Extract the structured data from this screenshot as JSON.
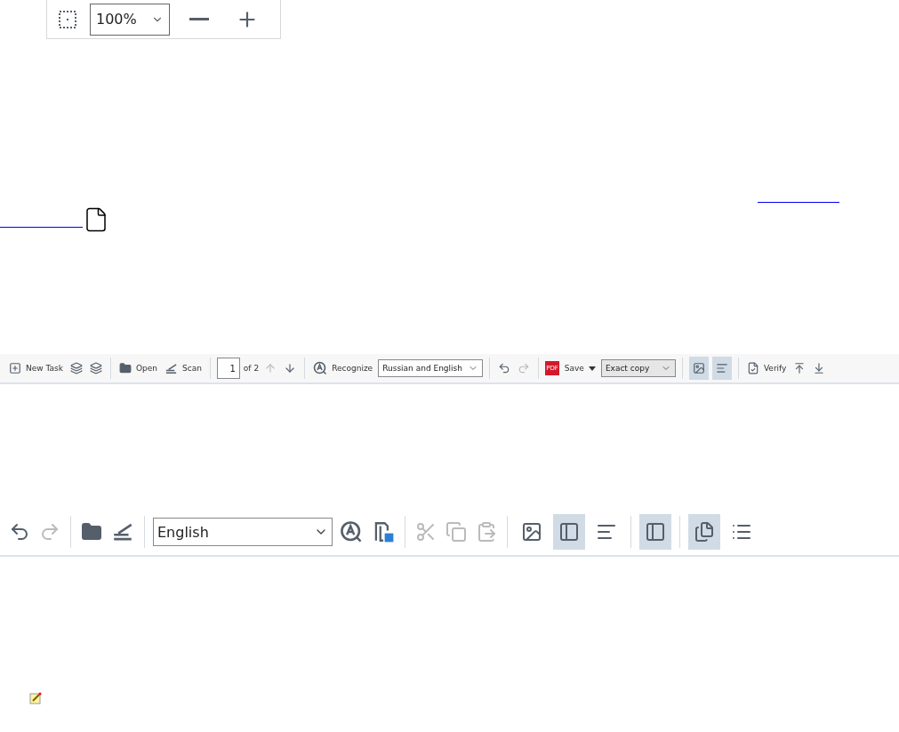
{
  "zoom_toolbar": {
    "zoom_value": "100%"
  },
  "main_toolbar": {
    "new_task": "New Task",
    "open": "Open",
    "scan": "Scan",
    "page_field": "1",
    "page_count": "of 2",
    "previous_page_disabled": true,
    "next_page_disabled": false,
    "recognize": "Recognize",
    "language": "Russian and English",
    "redo_disabled": true,
    "pdf_badge": "PDF",
    "save": "Save",
    "save_mode": "Exact copy",
    "view_toggles": [
      {
        "selected": true
      },
      {
        "selected": true
      }
    ],
    "verify": "Verify"
  },
  "editor_toolbar": {
    "redo_disabled": true,
    "language": "English",
    "edit_buttons": [
      {
        "disabled": true
      },
      {
        "disabled": true
      },
      {
        "disabled": true
      }
    ],
    "view_toggles": [
      {
        "selected": false
      },
      {
        "selected": true
      },
      {
        "selected": false
      }
    ],
    "panel_toggle": {
      "selected": true
    },
    "page_view_toggles": [
      {
        "selected": true
      },
      {
        "selected": false
      }
    ]
  }
}
